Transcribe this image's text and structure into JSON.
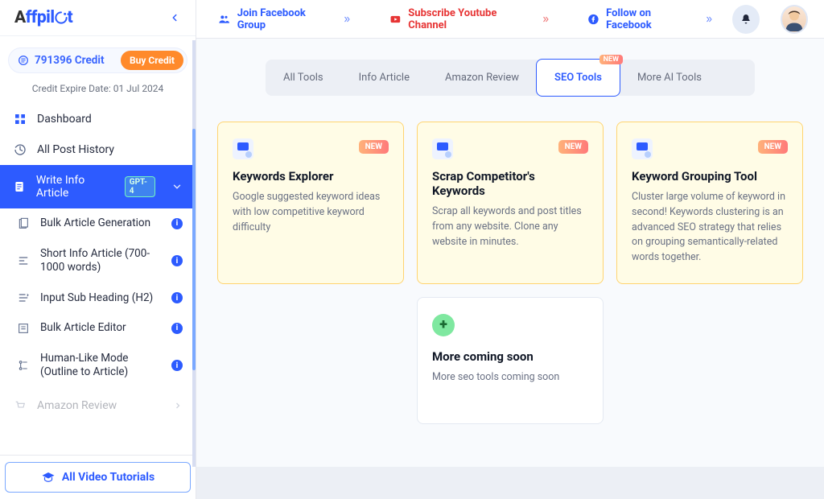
{
  "brand": {
    "text": "Affpilot"
  },
  "credit": {
    "amount": "791396 Credit",
    "buy_label": "Buy Credit",
    "expire": "Credit Expire Date: 01 Jul 2024"
  },
  "nav": {
    "dashboard": "Dashboard",
    "all_post_history": "All Post History",
    "write_info_article": "Write Info Article",
    "gpt_badge": "GPT-4",
    "bulk_article_generation": "Bulk Article Generation",
    "short_info_article": "Short Info Article (700-1000 words)",
    "input_sub_heading": "Input Sub Heading (H2)",
    "bulk_article_editor": "Bulk Article Editor",
    "human_like_mode": "Human-Like Mode (Outline to Article)",
    "amazon_review_partial": "Amazon Review",
    "video_tutorials": "All Video Tutorials"
  },
  "topbar": {
    "fb_group": "Join Facebook Group",
    "youtube": "Subscribe Youtube Channel",
    "fb_follow": "Follow on Facebook"
  },
  "tabs": {
    "all_tools": "All Tools",
    "info_article": "Info Article",
    "amazon_review": "Amazon Review",
    "seo_tools": "SEO Tools",
    "more_ai_tools": "More AI Tools",
    "new_badge": "NEW"
  },
  "cards": {
    "c1": {
      "title": "Keywords Explorer",
      "desc": "Google suggested keyword ideas with low competitive keyword difficulty",
      "new": "NEW"
    },
    "c2": {
      "title": "Scrap Competitor's Keywords",
      "desc": "Scrap all keywords and post titles from any website. Clone any website in minutes.",
      "new": "NEW"
    },
    "c3": {
      "title": "Keyword Grouping Tool",
      "desc": "Cluster large volume of keyword in second! Keywords clustering is an advanced SEO strategy that relies on grouping semantically-related words together.",
      "new": "NEW"
    },
    "c4": {
      "title": "More coming soon",
      "desc": "More seo tools coming soon"
    }
  }
}
